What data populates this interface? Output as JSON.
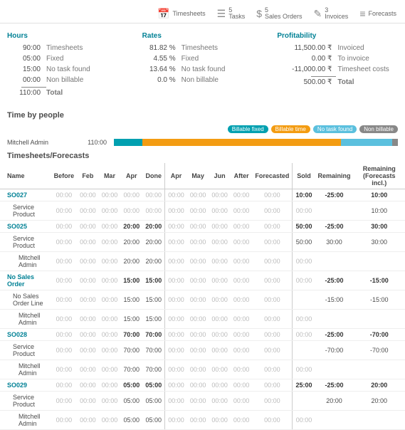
{
  "tabs": [
    {
      "icon": "📅",
      "label": "Timesheets",
      "count": ""
    },
    {
      "icon": "☰",
      "label": "Tasks",
      "count": "5"
    },
    {
      "icon": "$",
      "label": "Sales Orders",
      "count": "5"
    },
    {
      "icon": "✎",
      "label": "Invoices",
      "count": "3"
    },
    {
      "icon": "≡",
      "label": "Forecasts",
      "count": ""
    }
  ],
  "hours": {
    "title": "Hours",
    "rows": [
      {
        "v": "90:00",
        "l": "Timesheets"
      },
      {
        "v": "05:00",
        "l": "Fixed"
      },
      {
        "v": "15:00",
        "l": "No task found"
      },
      {
        "v": "00:00",
        "l": "Non billable"
      }
    ],
    "total": {
      "v": "110:00",
      "l": "Total"
    }
  },
  "rates": {
    "title": "Rates",
    "rows": [
      {
        "v": "81.82 %",
        "l": "Timesheets"
      },
      {
        "v": "4.55 %",
        "l": "Fixed"
      },
      {
        "v": "13.64 %",
        "l": "No task found"
      },
      {
        "v": "0.0 %",
        "l": "Non billable"
      }
    ]
  },
  "prof": {
    "title": "Profitability",
    "rows": [
      {
        "v": "11,500.00 ₹",
        "l": "Invoiced"
      },
      {
        "v": "0.00 ₹",
        "l": "To invoice"
      },
      {
        "v": "-11,000.00 ₹",
        "l": "Timesheet costs"
      }
    ],
    "total": {
      "v": "500.00 ₹",
      "l": "Total"
    }
  },
  "timeByPeople": {
    "title": "Time by people",
    "legend": [
      "Billable fixed",
      "Billable time",
      "No task found",
      "Non billable"
    ],
    "person": {
      "name": "Mitchell Admin",
      "value": "110:00",
      "segs": [
        {
          "c": "c-bf",
          "w": 10
        },
        {
          "c": "c-bt",
          "w": 70
        },
        {
          "c": "c-nt",
          "w": 18
        },
        {
          "c": "c-nb",
          "w": 2
        }
      ]
    }
  },
  "tfTitle": "Timesheets/Forecasts",
  "headers": [
    "Name",
    "Before",
    "Feb",
    "Mar",
    "Apr",
    "Done",
    "Apr",
    "May",
    "Jun",
    "After",
    "Forecasted",
    "Sold",
    "Remaining",
    "Remaining (Forecasts incl.)"
  ],
  "chart_data": {
    "type": "table",
    "title": "Timesheets/Forecasts",
    "columns": [
      "Name",
      "Before",
      "Feb",
      "Mar",
      "Apr",
      "Done",
      "Apr",
      "May",
      "Jun",
      "After",
      "Forecasted",
      "Sold",
      "Remaining",
      "Remaining (Forecasts incl.)"
    ],
    "rows": [
      {
        "name": "SO027",
        "link": true,
        "indent": 0,
        "cells": [
          "00:00",
          "00:00",
          "00:00",
          "00:00",
          "00:00",
          "00:00",
          "00:00",
          "00:00",
          "00:00",
          "00:00",
          "10:00",
          "-25:00",
          "10:00"
        ],
        "bold": [
          10,
          11,
          12
        ]
      },
      {
        "name": "Service Product",
        "link": false,
        "indent": 1,
        "cells": [
          "00:00",
          "00:00",
          "00:00",
          "00:00",
          "00:00",
          "00:00",
          "00:00",
          "00:00",
          "00:00",
          "00:00",
          "00:00",
          "",
          "10:00"
        ],
        "bold": []
      },
      {
        "name": "SO025",
        "link": true,
        "indent": 0,
        "cells": [
          "00:00",
          "00:00",
          "00:00",
          "20:00",
          "20:00",
          "00:00",
          "00:00",
          "00:00",
          "00:00",
          "00:00",
          "50:00",
          "-25:00",
          "30:00"
        ],
        "bold": [
          3,
          4,
          10,
          11,
          12
        ]
      },
      {
        "name": "Service Product",
        "link": false,
        "indent": 1,
        "cells": [
          "00:00",
          "00:00",
          "00:00",
          "20:00",
          "20:00",
          "00:00",
          "00:00",
          "00:00",
          "00:00",
          "00:00",
          "50:00",
          "30:00",
          "30:00"
        ],
        "bold": []
      },
      {
        "name": "Mitchell Admin",
        "link": false,
        "indent": 2,
        "cells": [
          "00:00",
          "00:00",
          "00:00",
          "20:00",
          "20:00",
          "00:00",
          "00:00",
          "00:00",
          "00:00",
          "00:00",
          "00:00",
          "",
          ""
        ],
        "bold": []
      },
      {
        "name": "No Sales Order",
        "link": true,
        "indent": 0,
        "cells": [
          "00:00",
          "00:00",
          "00:00",
          "15:00",
          "15:00",
          "00:00",
          "00:00",
          "00:00",
          "00:00",
          "00:00",
          "00:00",
          "-25:00",
          "-15:00"
        ],
        "bold": [
          3,
          4,
          11,
          12
        ]
      },
      {
        "name": "No Sales Order Line",
        "link": false,
        "indent": 1,
        "cells": [
          "00:00",
          "00:00",
          "00:00",
          "15:00",
          "15:00",
          "00:00",
          "00:00",
          "00:00",
          "00:00",
          "00:00",
          "",
          "-15:00",
          "-15:00"
        ],
        "bold": []
      },
      {
        "name": "Mitchell Admin",
        "link": false,
        "indent": 2,
        "cells": [
          "00:00",
          "00:00",
          "00:00",
          "15:00",
          "15:00",
          "00:00",
          "00:00",
          "00:00",
          "00:00",
          "00:00",
          "00:00",
          "",
          ""
        ],
        "bold": []
      },
      {
        "name": "SO028",
        "link": true,
        "indent": 0,
        "cells": [
          "00:00",
          "00:00",
          "00:00",
          "70:00",
          "70:00",
          "00:00",
          "00:00",
          "00:00",
          "00:00",
          "00:00",
          "00:00",
          "-25:00",
          "-70:00"
        ],
        "bold": [
          3,
          4,
          11,
          12
        ]
      },
      {
        "name": "Service Product",
        "link": false,
        "indent": 1,
        "cells": [
          "00:00",
          "00:00",
          "00:00",
          "70:00",
          "70:00",
          "00:00",
          "00:00",
          "00:00",
          "00:00",
          "00:00",
          "",
          "-70:00",
          "-70:00"
        ],
        "bold": []
      },
      {
        "name": "Mitchell Admin",
        "link": false,
        "indent": 2,
        "cells": [
          "00:00",
          "00:00",
          "00:00",
          "70:00",
          "70:00",
          "00:00",
          "00:00",
          "00:00",
          "00:00",
          "00:00",
          "00:00",
          "",
          ""
        ],
        "bold": []
      },
      {
        "name": "SO029",
        "link": true,
        "indent": 0,
        "cells": [
          "00:00",
          "00:00",
          "00:00",
          "05:00",
          "05:00",
          "00:00",
          "00:00",
          "00:00",
          "00:00",
          "00:00",
          "25:00",
          "-25:00",
          "20:00"
        ],
        "bold": [
          3,
          4,
          10,
          11,
          12
        ]
      },
      {
        "name": "Service Product",
        "link": false,
        "indent": 1,
        "cells": [
          "00:00",
          "00:00",
          "00:00",
          "05:00",
          "05:00",
          "00:00",
          "00:00",
          "00:00",
          "00:00",
          "00:00",
          "",
          "20:00",
          "20:00"
        ],
        "bold": []
      },
      {
        "name": "Mitchell Admin",
        "link": false,
        "indent": 2,
        "cells": [
          "00:00",
          "00:00",
          "00:00",
          "05:00",
          "05:00",
          "00:00",
          "00:00",
          "00:00",
          "00:00",
          "00:00",
          "00:00",
          "",
          ""
        ],
        "bold": []
      }
    ]
  }
}
